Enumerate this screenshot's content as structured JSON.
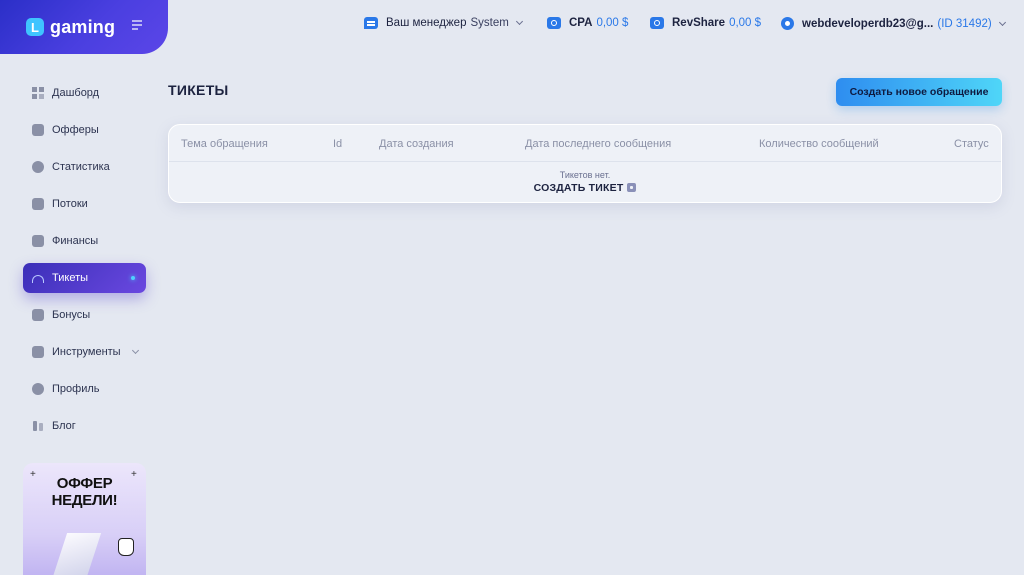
{
  "brand": {
    "logo_letter": "L",
    "name": "gaming"
  },
  "topbar": {
    "manager_label": "Ваш менеджер",
    "manager_value": "System",
    "cpa_label": "CPA",
    "cpa_value": "0,00 $",
    "revshare_label": "RevShare",
    "revshare_value": "0,00 $",
    "user_email": "webdeveloperdb23@g...",
    "user_id": "(ID 31492)",
    "accent_color": "#2a78e8"
  },
  "sidebar": {
    "items": [
      {
        "label": "Дашборд",
        "icon": "dashboard-icon"
      },
      {
        "label": "Офферы",
        "icon": "offers-icon"
      },
      {
        "label": "Статистика",
        "icon": "statistics-icon"
      },
      {
        "label": "Потоки",
        "icon": "streams-icon"
      },
      {
        "label": "Финансы",
        "icon": "finance-icon"
      },
      {
        "label": "Тикеты",
        "icon": "headset-icon",
        "active": true
      },
      {
        "label": "Бонусы",
        "icon": "bonus-icon"
      },
      {
        "label": "Инструменты",
        "icon": "tools-icon"
      },
      {
        "label": "Профиль",
        "icon": "profile-icon"
      },
      {
        "label": "Блог",
        "icon": "blog-icon"
      }
    ]
  },
  "offer_card": {
    "title_line1": "ОФФЕР",
    "title_line2": "НЕДЕЛИ!",
    "sparkle": "+"
  },
  "main": {
    "title": "ТИКЕТЫ",
    "create_button": "Создать новое обращение",
    "table": {
      "columns": [
        "Тема обращения",
        "Id",
        "Дата создания",
        "Дата последнего сообщения",
        "Количество сообщений",
        "Статус"
      ],
      "empty_text": "Тикетов нет.",
      "empty_link": "СОЗДАТЬ ТИКЕТ"
    }
  }
}
